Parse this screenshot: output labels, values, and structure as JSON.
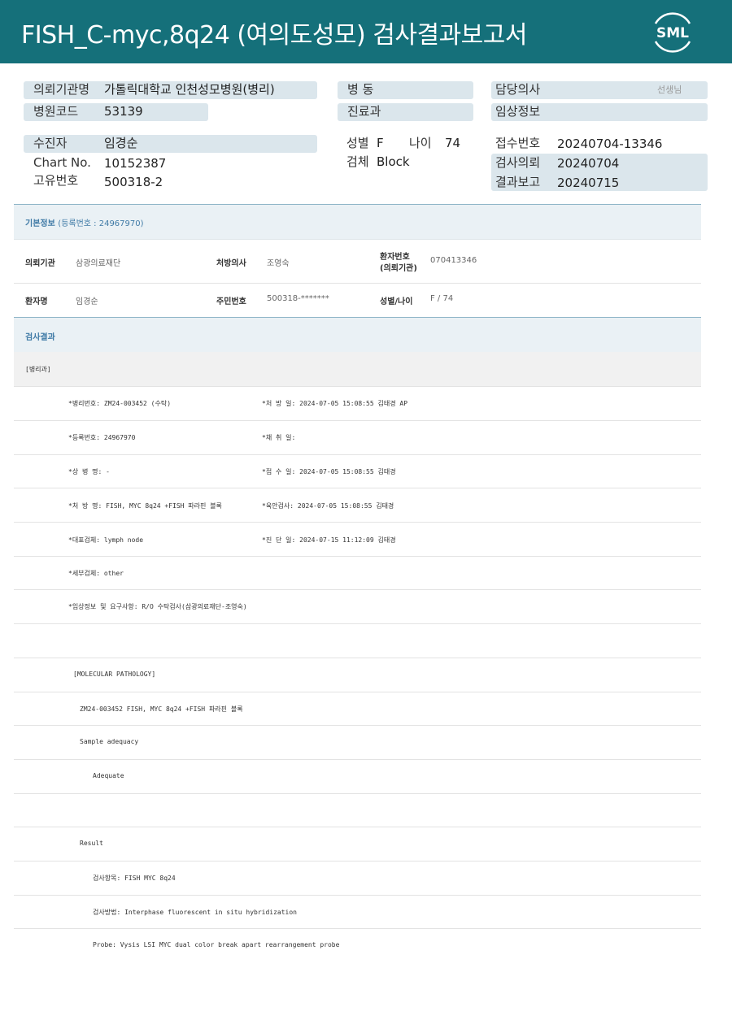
{
  "header": {
    "title": "FISH_C-myc,8q24 (여의도성모) 검사결과보고서",
    "logo_text": "SML"
  },
  "top": {
    "requesting_org_label": "의뢰기관명",
    "requesting_org_value": "가톨릭대학교 인천성모병원(병리)",
    "hospital_code_label": "병원코드",
    "hospital_code_value": "53139",
    "ward_label": "병 동",
    "department_label": "진료과",
    "doctor_label": "담당의사",
    "doctor_suffix": "선생님",
    "clinical_info_label": "임상정보",
    "patient_label": "수진자",
    "patient_value": "임경순",
    "chart_label": "Chart No.",
    "chart_value": "10152387",
    "unique_label": "고유번호",
    "unique_value": "500318-2",
    "sex_label": "성별",
    "sex_value": "F",
    "age_label": "나이",
    "age_value": "74",
    "specimen_label": "검체",
    "specimen_value": "Block",
    "receipt_label": "접수번호",
    "receipt_value": "20240704-13346",
    "request_label": "검사의뢰",
    "request_value": "20240704",
    "report_label": "결과보고",
    "report_value": "20240715"
  },
  "basic_info": {
    "title": "기본정보",
    "sub": "(등록번호 : 24967970)",
    "org_label": "의뢰기관",
    "org_value": "삼광의료재단",
    "prescriber_label": "처방의사",
    "prescriber_value": "조영숙",
    "patient_no_label_1": "환자번호",
    "patient_no_label_2": "(의뢰기관)",
    "patient_no_value": "070413346",
    "name_label": "환자명",
    "name_value": "임경순",
    "resident_label": "주민번호",
    "resident_value": "500318-*******",
    "sexage_label": "성별/나이",
    "sexage_value": "F / 74"
  },
  "results": {
    "title": "검사결과",
    "category": "[병리과]",
    "lines": [
      {
        "left": "*병리번호: ZM24-003452 (수탁)",
        "right": "*처 방 일: 2024-07-05 15:08:55  김태경 AP"
      },
      {
        "left": "*등록번호: 24967970",
        "right": "*채 취 일:"
      },
      {
        "left": "*상 병 명: -",
        "right": "*접 수 일: 2024-07-05 15:08:55  김태경"
      },
      {
        "left": "*처 방 명: FISH, MYC 8q24 +FISH 파라핀 블록",
        "right": "*육안검사: 2024-07-05 15:08:55  김태경"
      },
      {
        "left": "*대표검체: lymph node",
        "right": "*진 단 일: 2024-07-15 11:12:09  김태경"
      },
      {
        "left": "*세부검체: other",
        "right": ""
      },
      {
        "left": "*임상정보 및 요구사항: R/O 수탁검사(삼광의료재단-조영숙)",
        "right": ""
      }
    ],
    "molecular_header": "[MOLECULAR PATHOLOGY]",
    "molecular_id": "ZM24-003452     FISH, MYC 8q24 +FISH 파라핀 블록",
    "sample_adequacy": "Sample adequacy",
    "adequate": "Adequate",
    "result": "Result",
    "test_item": "검사항목: FISH MYC 8q24",
    "test_method": "검사방법: Interphase fluorescent in situ hybridization",
    "probe": "Probe: Vysis LSI MYC dual color break apart rearrangement probe"
  }
}
